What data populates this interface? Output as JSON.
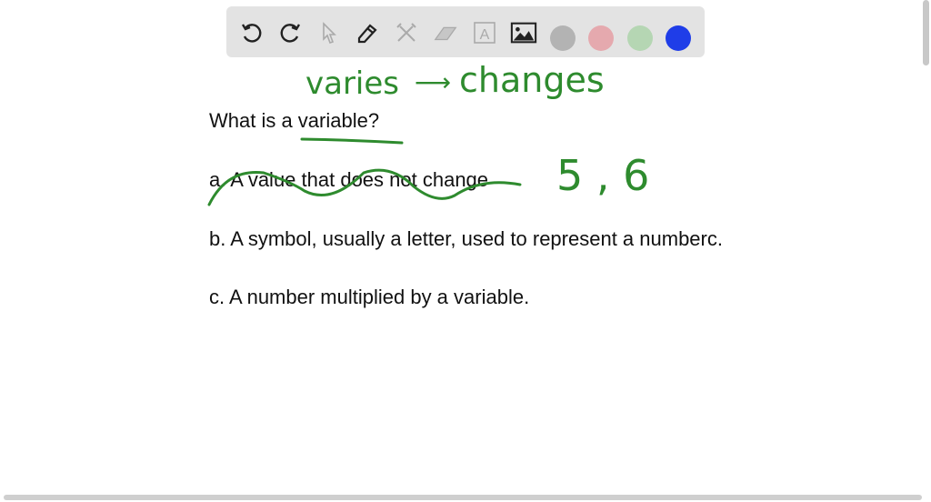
{
  "toolbar": {
    "tools": [
      {
        "name": "undo-icon",
        "glyph": "↺"
      },
      {
        "name": "redo-icon",
        "glyph": "↻"
      },
      {
        "name": "select-pointer-icon",
        "glyph": "⇖"
      },
      {
        "name": "pen-icon",
        "glyph": "✎"
      },
      {
        "name": "tools-icon",
        "glyph": "⚒"
      },
      {
        "name": "eraser-icon",
        "glyph": "▱"
      },
      {
        "name": "text-box-icon",
        "glyph": "A"
      },
      {
        "name": "image-icon",
        "glyph": "▣"
      }
    ],
    "colors": [
      "#b3b3b3",
      "#e5a9ae",
      "#b5d6b3",
      "#1f3de8"
    ]
  },
  "content": {
    "question": "What is a variable?",
    "option_a": "a. A value that does not change",
    "option_b": "b. A symbol, usually a letter, used to represent a numberc.",
    "option_c": "c. A number multiplied by a variable."
  },
  "annotations": {
    "varies": "varies",
    "arrow": "⟶",
    "changes": "changes",
    "numbers": "5 , 6"
  },
  "ink_color": "#2e8b2e"
}
